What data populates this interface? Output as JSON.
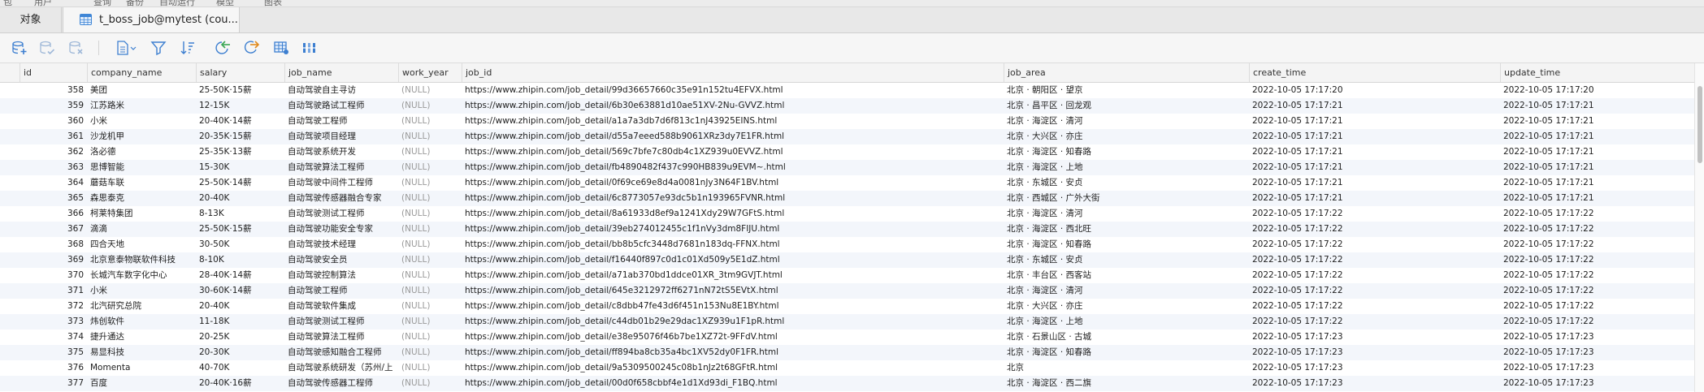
{
  "menu": [
    "包",
    "用户",
    "查询",
    "备份",
    "自动运行",
    "模型",
    "图表"
  ],
  "tabs": [
    {
      "label": "对象",
      "active": false
    },
    {
      "label": "t_boss_job@mytest (cou...",
      "active": true
    }
  ],
  "toolbar": {
    "buttons": [
      {
        "name": "add-record-icon"
      },
      {
        "name": "apply-changes-icon"
      },
      {
        "name": "discard-changes-icon"
      },
      {
        "name": "text-view-icon"
      },
      {
        "name": "filter-icon"
      },
      {
        "name": "sort-icon"
      },
      {
        "name": "import-icon"
      },
      {
        "name": "export-icon"
      },
      {
        "name": "grid-view-icon"
      },
      {
        "name": "column-settings-icon"
      }
    ]
  },
  "columns": [
    "id",
    "company_name",
    "salary",
    "job_name",
    "work_year",
    "job_id",
    "job_area",
    "create_time",
    "update_time"
  ],
  "null_text": "(NULL)",
  "rows": [
    {
      "id": "358",
      "company_name": "美团",
      "salary": "25-50K·15薪",
      "job_name": "自动驾驶自主寻访",
      "work_year": "(NULL)",
      "job_id": "https://www.zhipin.com/job_detail/99d36657660c35e91n152tu4EFVX.html",
      "job_area": "北京 · 朝阳区 · 望京",
      "create_time": "2022-10-05 17:17:20",
      "update_time": "2022-10-05 17:17:20"
    },
    {
      "id": "359",
      "company_name": "江苏路米",
      "salary": "12-15K",
      "job_name": "自动驾驶路试工程师",
      "work_year": "(NULL)",
      "job_id": "https://www.zhipin.com/job_detail/6b30e63881d10ae51XV-2Nu-GVVZ.html",
      "job_area": "北京 · 昌平区 · 回龙观",
      "create_time": "2022-10-05 17:17:21",
      "update_time": "2022-10-05 17:17:21"
    },
    {
      "id": "360",
      "company_name": "小米",
      "salary": "20-40K·14薪",
      "job_name": "自动驾驶工程师",
      "work_year": "(NULL)",
      "job_id": "https://www.zhipin.com/job_detail/a1a7a3db7d6f813c1nJ43925EINS.html",
      "job_area": "北京 · 海淀区 · 清河",
      "create_time": "2022-10-05 17:17:21",
      "update_time": "2022-10-05 17:17:21"
    },
    {
      "id": "361",
      "company_name": "沙龙机甲",
      "salary": "20-35K·15薪",
      "job_name": "自动驾驶项目经理",
      "work_year": "(NULL)",
      "job_id": "https://www.zhipin.com/job_detail/d55a7eeed588b9061XRz3dy7E1FR.html",
      "job_area": "北京 · 大兴区 · 亦庄",
      "create_time": "2022-10-05 17:17:21",
      "update_time": "2022-10-05 17:17:21"
    },
    {
      "id": "362",
      "company_name": "洛必德",
      "salary": "25-35K·13薪",
      "job_name": "自动驾驶系统开发",
      "work_year": "(NULL)",
      "job_id": "https://www.zhipin.com/job_detail/569c7bfe7c80db4c1XZ939u0EVVZ.html",
      "job_area": "北京 · 海淀区 · 知春路",
      "create_time": "2022-10-05 17:17:21",
      "update_time": "2022-10-05 17:17:21"
    },
    {
      "id": "363",
      "company_name": "思博智能",
      "salary": "15-30K",
      "job_name": "自动驾驶算法工程师",
      "work_year": "(NULL)",
      "job_id": "https://www.zhipin.com/job_detail/fb4890482f437c990HB839u9EVM~.html",
      "job_area": "北京 · 海淀区 · 上地",
      "create_time": "2022-10-05 17:17:21",
      "update_time": "2022-10-05 17:17:21"
    },
    {
      "id": "364",
      "company_name": "蘑菇车联",
      "salary": "25-50K·14薪",
      "job_name": "自动驾驶中间件工程师",
      "work_year": "(NULL)",
      "job_id": "https://www.zhipin.com/job_detail/0f69ce69e8d4a0081nJy3N64F1BV.html",
      "job_area": "北京 · 东城区 · 安贞",
      "create_time": "2022-10-05 17:17:21",
      "update_time": "2022-10-05 17:17:21"
    },
    {
      "id": "365",
      "company_name": "森思泰克",
      "salary": "20-40K",
      "job_name": "自动驾驶传感器融合专家",
      "work_year": "(NULL)",
      "job_id": "https://www.zhipin.com/job_detail/6c8773057e93dc5b1n193965FVNR.html",
      "job_area": "北京 · 西城区 · 广外大街",
      "create_time": "2022-10-05 17:17:21",
      "update_time": "2022-10-05 17:17:21"
    },
    {
      "id": "366",
      "company_name": "柯莱特集团",
      "salary": "8-13K",
      "job_name": "自动驾驶测试工程师",
      "work_year": "(NULL)",
      "job_id": "https://www.zhipin.com/job_detail/8a61933d8ef9a1241Xdy29W7GFtS.html",
      "job_area": "北京 · 海淀区 · 清河",
      "create_time": "2022-10-05 17:17:22",
      "update_time": "2022-10-05 17:17:22"
    },
    {
      "id": "367",
      "company_name": "滴滴",
      "salary": "25-50K·15薪",
      "job_name": "自动驾驶功能安全专家",
      "work_year": "(NULL)",
      "job_id": "https://www.zhipin.com/job_detail/39eb274012455c1f1nVy3dm8FIJU.html",
      "job_area": "北京 · 海淀区 · 西北旺",
      "create_time": "2022-10-05 17:17:22",
      "update_time": "2022-10-05 17:17:22"
    },
    {
      "id": "368",
      "company_name": "四合天地",
      "salary": "30-50K",
      "job_name": "自动驾驶技术经理",
      "work_year": "(NULL)",
      "job_id": "https://www.zhipin.com/job_detail/bb8b5cfc3448d7681n183dq-FFNX.html",
      "job_area": "北京 · 海淀区 · 知春路",
      "create_time": "2022-10-05 17:17:22",
      "update_time": "2022-10-05 17:17:22"
    },
    {
      "id": "369",
      "company_name": "北京意泰物联软件科技",
      "salary": "8-10K",
      "job_name": "自动驾驶安全员",
      "work_year": "(NULL)",
      "job_id": "https://www.zhipin.com/job_detail/f16440f897c0d1c01Xd509y5E1dZ.html",
      "job_area": "北京 · 东城区 · 安贞",
      "create_time": "2022-10-05 17:17:22",
      "update_time": "2022-10-05 17:17:22"
    },
    {
      "id": "370",
      "company_name": "长城汽车数字化中心",
      "salary": "28-40K·14薪",
      "job_name": "自动驾驶控制算法",
      "work_year": "(NULL)",
      "job_id": "https://www.zhipin.com/job_detail/a71ab370bd1ddce01XR_3tm9GVJT.html",
      "job_area": "北京 · 丰台区 · 西客站",
      "create_time": "2022-10-05 17:17:22",
      "update_time": "2022-10-05 17:17:22"
    },
    {
      "id": "371",
      "company_name": "小米",
      "salary": "30-60K·14薪",
      "job_name": "自动驾驶工程师",
      "work_year": "(NULL)",
      "job_id": "https://www.zhipin.com/job_detail/645e3212972ff6271nN72tS5EVtX.html",
      "job_area": "北京 · 海淀区 · 清河",
      "create_time": "2022-10-05 17:17:22",
      "update_time": "2022-10-05 17:17:22"
    },
    {
      "id": "372",
      "company_name": "北汽研究总院",
      "salary": "20-40K",
      "job_name": "自动驾驶软件集成",
      "work_year": "(NULL)",
      "job_id": "https://www.zhipin.com/job_detail/c8dbb47fe43d6f451n153Nu8E1BY.html",
      "job_area": "北京 · 大兴区 · 亦庄",
      "create_time": "2022-10-05 17:17:22",
      "update_time": "2022-10-05 17:17:22"
    },
    {
      "id": "373",
      "company_name": "炜创软件",
      "salary": "11-18K",
      "job_name": "自动驾驶测试工程师",
      "work_year": "(NULL)",
      "job_id": "https://www.zhipin.com/job_detail/c44db01b29e29dac1XZ939u1F1pR.html",
      "job_area": "北京 · 海淀区 · 上地",
      "create_time": "2022-10-05 17:17:22",
      "update_time": "2022-10-05 17:17:22"
    },
    {
      "id": "374",
      "company_name": "捷升通达",
      "salary": "20-25K",
      "job_name": "自动驾驶算法工程师",
      "work_year": "(NULL)",
      "job_id": "https://www.zhipin.com/job_detail/e38e95076f46b7be1XZ72t-9FFdV.html",
      "job_area": "北京 · 石景山区 · 古城",
      "create_time": "2022-10-05 17:17:23",
      "update_time": "2022-10-05 17:17:23"
    },
    {
      "id": "375",
      "company_name": "易显科技",
      "salary": "20-30K",
      "job_name": "自动驾驶感知融合工程师",
      "work_year": "(NULL)",
      "job_id": "https://www.zhipin.com/job_detail/ff894ba8cb35a4bc1XV52dy0F1FR.html",
      "job_area": "北京 · 海淀区 · 知春路",
      "create_time": "2022-10-05 17:17:23",
      "update_time": "2022-10-05 17:17:23"
    },
    {
      "id": "376",
      "company_name": "Momenta",
      "salary": "40-70K",
      "job_name": "自动驾驶系统研发（苏州/上",
      "work_year": "(NULL)",
      "job_id": "https://www.zhipin.com/job_detail/9a5309500245c08b1nJz2t68GFtR.html",
      "job_area": "北京",
      "create_time": "2022-10-05 17:17:23",
      "update_time": "2022-10-05 17:17:23"
    },
    {
      "id": "377",
      "company_name": "百度",
      "salary": "20-40K·16薪",
      "job_name": "自动驾驶传感器工程师",
      "work_year": "(NULL)",
      "job_id": "https://www.zhipin.com/job_detail/00d0f658cbbf4e1d1Xd93di_F1BQ.html",
      "job_area": "北京 · 海淀区 · 西二旗",
      "create_time": "2022-10-05 17:17:23",
      "update_time": "2022-10-05 17:17:23"
    }
  ]
}
